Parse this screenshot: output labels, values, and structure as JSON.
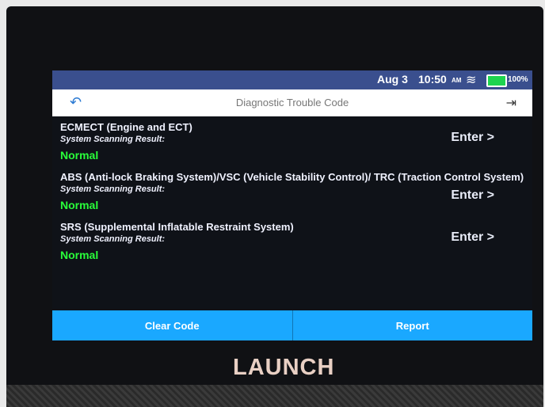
{
  "status_bar": {
    "date": "Aug 3",
    "time": "10:50",
    "ampm": "AM",
    "battery_pct": "100%"
  },
  "title_bar": {
    "title": "Diagnostic Trouble Code"
  },
  "systems": [
    {
      "name": "ECMECT (Engine and ECT)",
      "scan_label": "System Scanning Result:",
      "status": "Normal",
      "action": "Enter >"
    },
    {
      "name": "ABS (Anti-lock Braking System)/VSC (Vehicle Stability Control)/ TRC (Traction Control System)",
      "scan_label": "System Scanning Result:",
      "status": "Normal",
      "action": "Enter >"
    },
    {
      "name": "SRS (Supplemental Inflatable Restraint System)",
      "scan_label": "System Scanning Result:",
      "status": "Normal",
      "action": "Enter >"
    }
  ],
  "buttons": {
    "clear": "Clear Code",
    "report": "Report"
  },
  "brand": {
    "logo_text": "LAUNCH"
  },
  "colors": {
    "status_normal": "#29ff3a",
    "button_blue": "#1aa8ff",
    "statusbar": "#3a4f8e"
  }
}
